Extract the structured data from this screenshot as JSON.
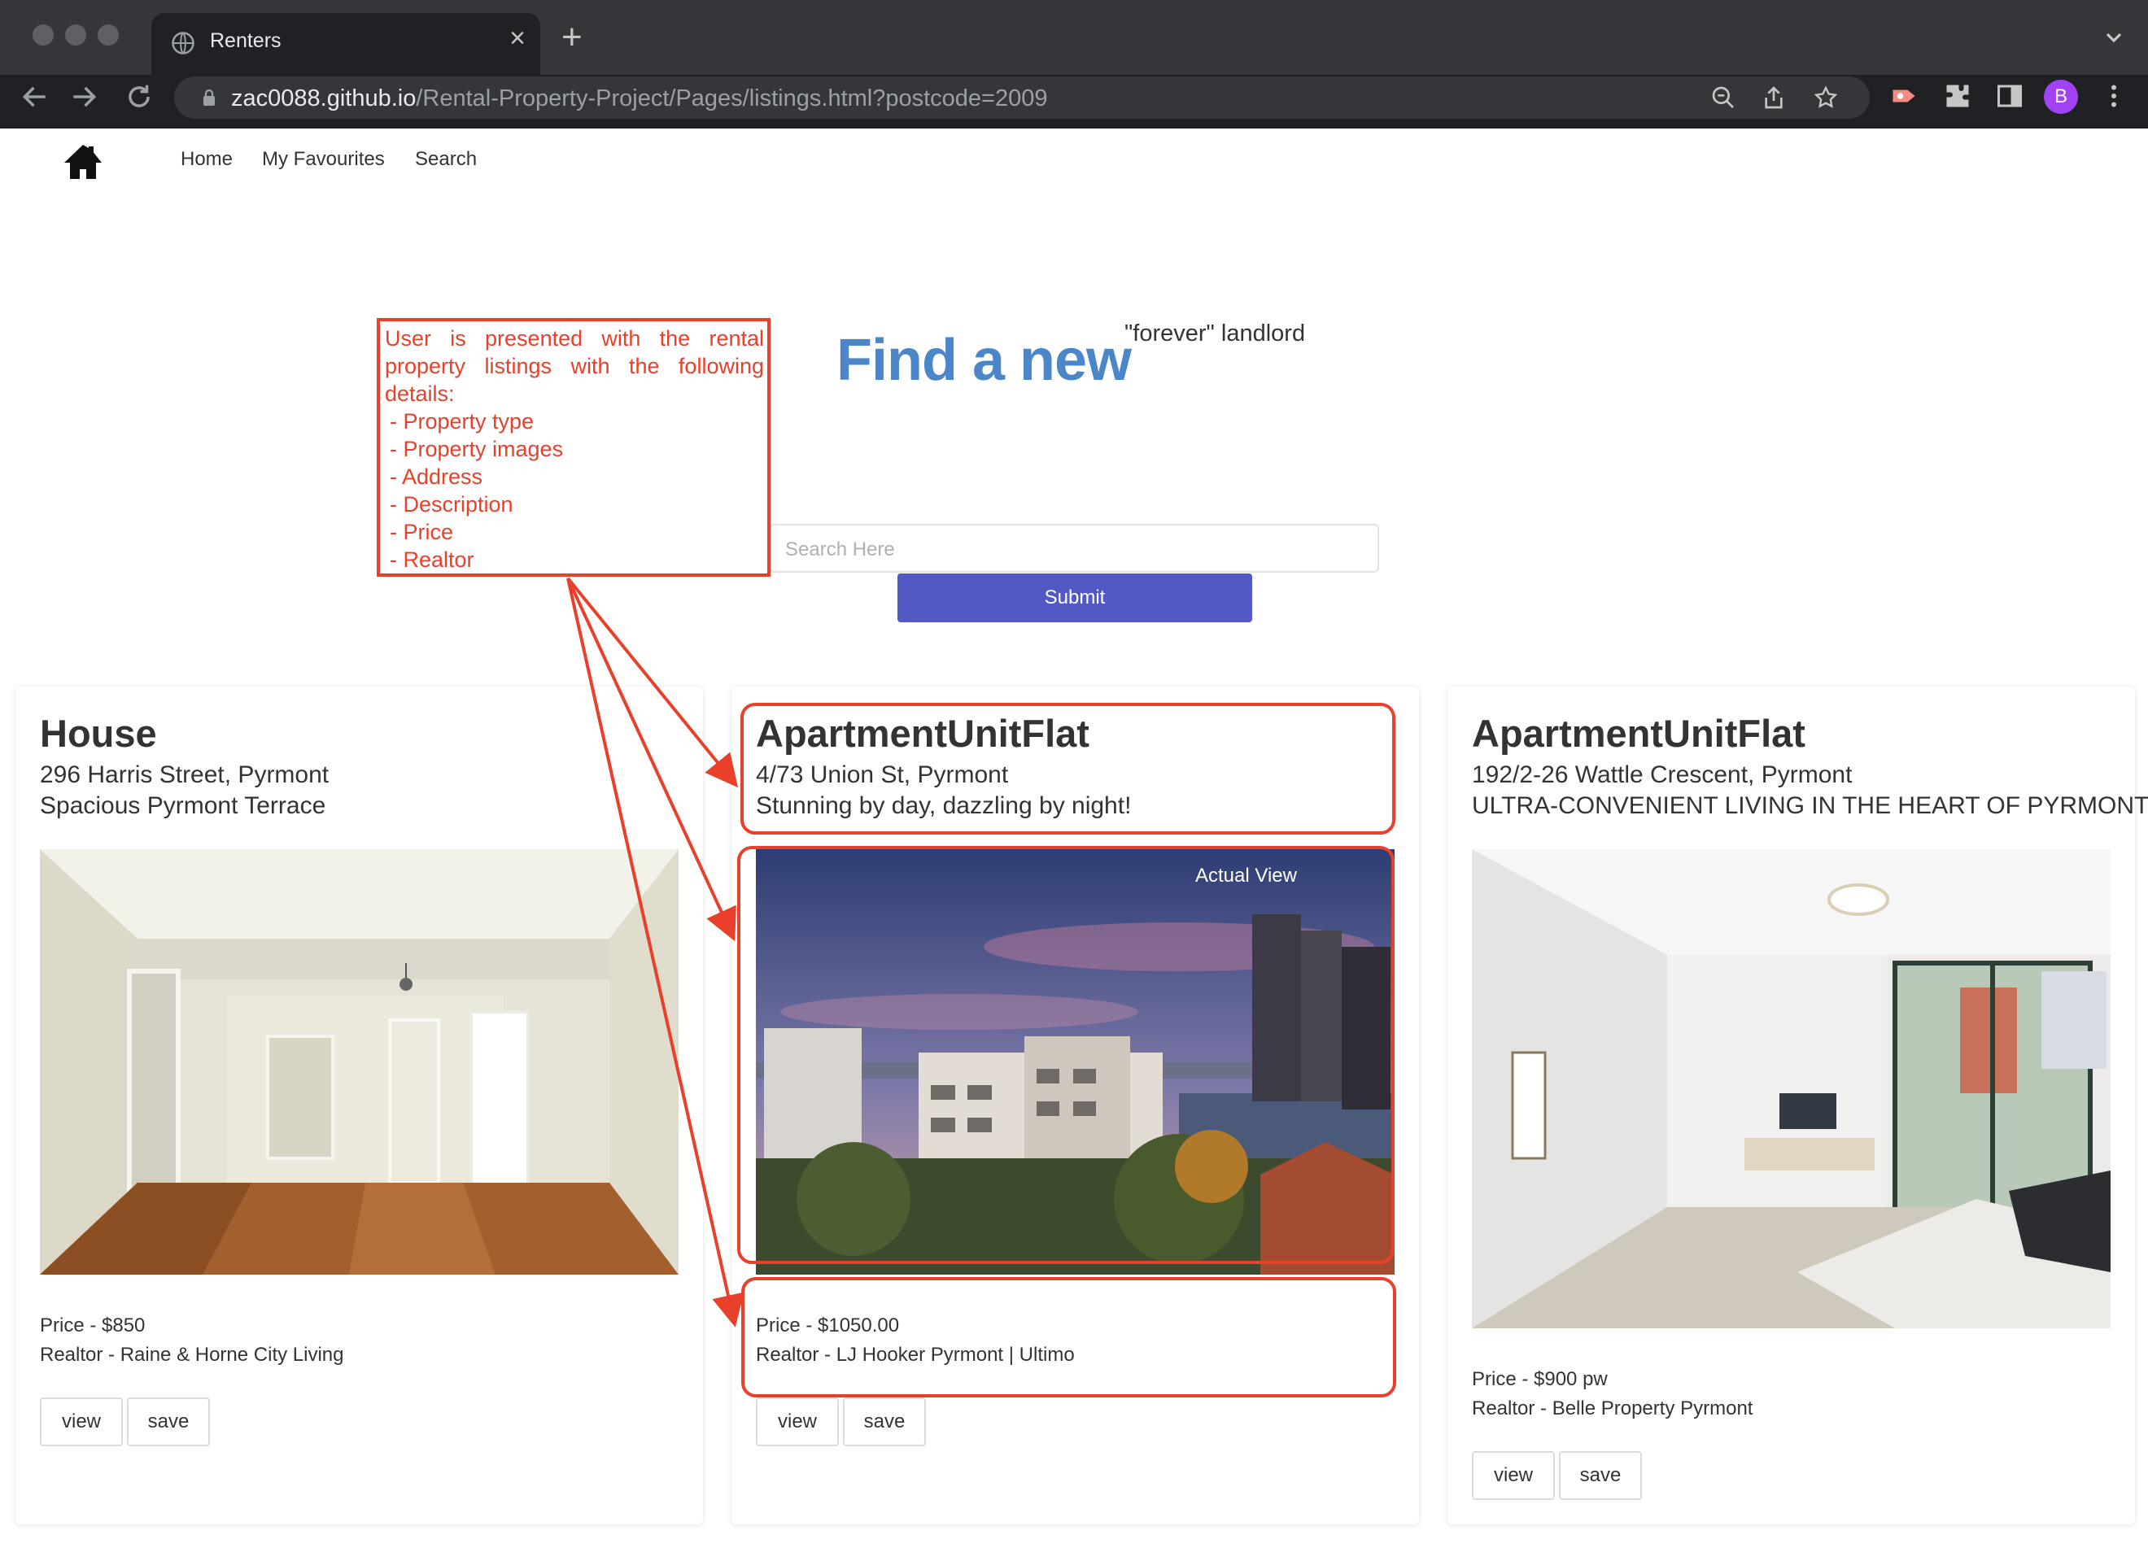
{
  "browser": {
    "tab_title": "Renters",
    "url_host": "zac0088.github.io",
    "url_path": "/Rental-Property-Project/Pages/listings.html?postcode=2009",
    "profile_initial": "B",
    "profile_color": "#a142f4"
  },
  "nav": {
    "logo_icon": "home-icon",
    "items": [
      "Home",
      "My Favourites",
      "Search"
    ]
  },
  "hero": {
    "title": "Find a new",
    "superscript": "\"forever\" landlord",
    "title_color": "#4a86c8"
  },
  "search": {
    "placeholder": "Search Here",
    "submit_label": "Submit",
    "submit_color": "#5258c4"
  },
  "listings": [
    {
      "type": "House",
      "address": "296 Harris Street, Pyrmont",
      "description": "Spacious Pyrmont Terrace",
      "image_alt": "Empty terrace interior with timber floorboards",
      "price": "Price - $850",
      "realtor": "Realtor - Raine & Horne City Living",
      "view_label": "view",
      "save_label": "save"
    },
    {
      "type": "ApartmentUnitFlat",
      "address": "4/73 Union St, Pyrmont",
      "description": "Stunning by day, dazzling by night!",
      "image_caption": "Actual View",
      "price": "Price - $1050.00",
      "realtor": "Realtor - LJ Hooker Pyrmont | Ultimo",
      "view_label": "view",
      "save_label": "save"
    },
    {
      "type": "ApartmentUnitFlat",
      "address": "192/2-26 Wattle Crescent, Pyrmont",
      "description": "ULTRA-CONVENIENT LIVING IN THE HEART OF PYRMONT",
      "image_alt": "Apartment living room with balcony",
      "price": "Price - $900 pw",
      "realtor": "Realtor - Belle Property Pyrmont",
      "view_label": "view",
      "save_label": "save"
    }
  ],
  "annotation": {
    "intro_line1": "User is presented with the rental",
    "intro_line2": "property listings with the following",
    "intro_line3": "details:",
    "items": [
      "- Property type",
      "- Property images",
      "- Address",
      "- Description",
      "- Price",
      "- Realtor"
    ],
    "color": "#e8402a"
  }
}
